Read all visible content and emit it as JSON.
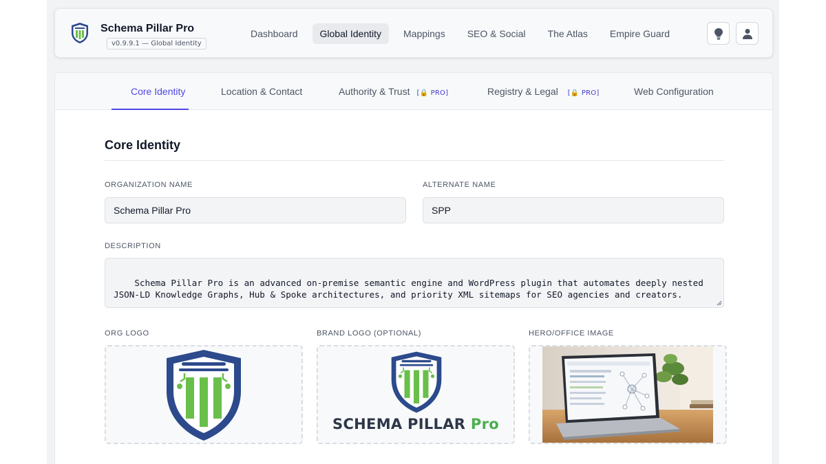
{
  "app": {
    "title": "Schema Pillar Pro",
    "version_badge": "v0.9.9.1 — Global Identity"
  },
  "nav": {
    "items": [
      {
        "label": "Dashboard",
        "active": false
      },
      {
        "label": "Global Identity",
        "active": true
      },
      {
        "label": "Mappings",
        "active": false
      },
      {
        "label": "SEO & Social",
        "active": false
      },
      {
        "label": "The Atlas",
        "active": false
      },
      {
        "label": "Empire Guard",
        "active": false
      }
    ],
    "icons": [
      "lightbulb-icon",
      "user-icon"
    ]
  },
  "tabs": [
    {
      "label": "Core Identity",
      "active": true
    },
    {
      "label": "Location & Contact",
      "active": false
    },
    {
      "label": "Authority & Trust",
      "active": false,
      "pro": "PRO"
    },
    {
      "label": "Registry & Legal",
      "active": false,
      "pro": "PRO"
    },
    {
      "label": "Web Configuration",
      "active": false
    }
  ],
  "section": {
    "title": "Core Identity"
  },
  "fields": {
    "organization_name": {
      "label": "ORGANIZATION NAME",
      "value": "Schema Pillar Pro"
    },
    "alternate_name": {
      "label": "ALTERNATE NAME",
      "value": "SPP"
    },
    "description": {
      "label": "DESCRIPTION",
      "value": "Schema Pillar Pro is an advanced on-premise semantic engine and WordPress plugin that automates deeply nested\nJSON-LD Knowledge Graphs, Hub & Spoke architectures, and priority XML sitemaps for SEO agencies and creators."
    },
    "org_logo": {
      "label": "ORG LOGO"
    },
    "brand_logo": {
      "label": "BRAND LOGO (OPTIONAL)",
      "wordmark_main": "SCHEMA PILLAR",
      "wordmark_pro": "Pro"
    },
    "hero_image": {
      "label": "HERO/OFFICE IMAGE"
    }
  },
  "colors": {
    "accent": "#4f46e5",
    "shield_blue": "#2c4a8c",
    "shield_green": "#6abf4b",
    "pro_lock": "#d97706"
  }
}
